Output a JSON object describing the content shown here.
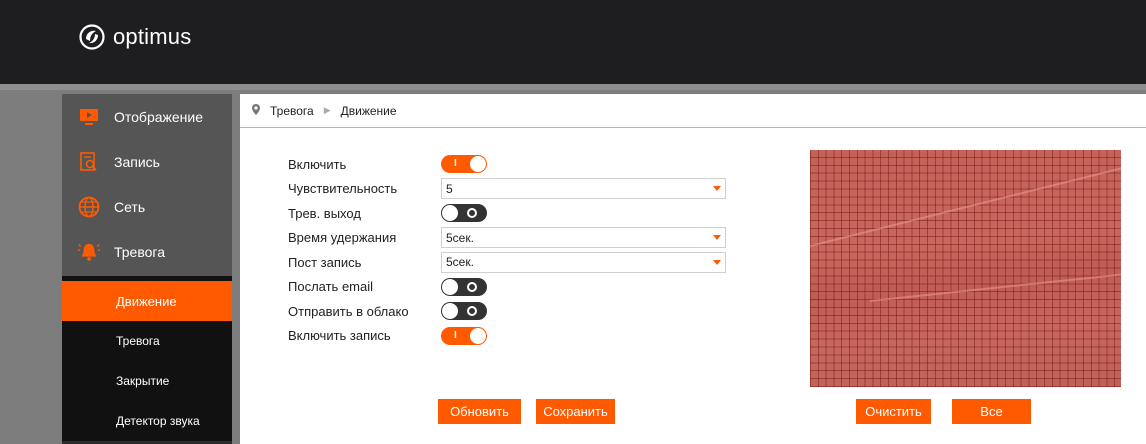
{
  "brand": {
    "name": "optimus"
  },
  "sidebar": {
    "main_items": [
      {
        "label": "Отображение",
        "icon": "monitor-icon"
      },
      {
        "label": "Запись",
        "icon": "record-search-icon"
      },
      {
        "label": "Сеть",
        "icon": "globe-icon"
      },
      {
        "label": "Тревога",
        "icon": "alarm-bell-icon"
      }
    ],
    "sub_items": [
      {
        "label": "Движение",
        "active": true
      },
      {
        "label": "Тревога",
        "active": false
      },
      {
        "label": "Закрытие",
        "active": false
      },
      {
        "label": "Детектор звука",
        "active": false
      }
    ]
  },
  "breadcrumb": {
    "section": "Тревога",
    "page": "Движение"
  },
  "form": {
    "enable": {
      "label": "Включить",
      "value": true
    },
    "sensitivity": {
      "label": "Чувствительность",
      "value": "5"
    },
    "alarm_out": {
      "label": "Трев. выход",
      "value": false
    },
    "hold_time": {
      "label": "Время удержания",
      "value": "5сек."
    },
    "post_record": {
      "label": "Пост запись",
      "value": "5сек."
    },
    "send_email": {
      "label": "Послать email",
      "value": false
    },
    "send_cloud": {
      "label": "Отправить в облако",
      "value": false
    },
    "enable_record": {
      "label": "Включить запись",
      "value": true
    }
  },
  "buttons": {
    "refresh": "Обновить",
    "save": "Сохранить",
    "clear": "Очистить",
    "all": "Все"
  },
  "colors": {
    "accent": "#ff5a00",
    "topbar": "#1e1e21",
    "sidebar_top": "#555555"
  }
}
